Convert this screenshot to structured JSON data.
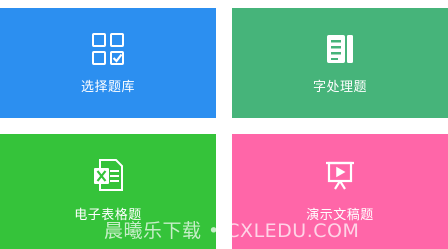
{
  "tiles": [
    {
      "label": "选择题库",
      "icon": "checkbox-grid-icon",
      "color": "#2C8FF0"
    },
    {
      "label": "字处理题",
      "icon": "word-document-icon",
      "color": "#46B47A"
    },
    {
      "label": "电子表格题",
      "icon": "excel-icon",
      "color": "#35C33A"
    },
    {
      "label": "演示文稿题",
      "icon": "presentation-icon",
      "color": "#FF66A8"
    }
  ],
  "watermark": "晨曦乐下载 • CXLEDU.COM"
}
